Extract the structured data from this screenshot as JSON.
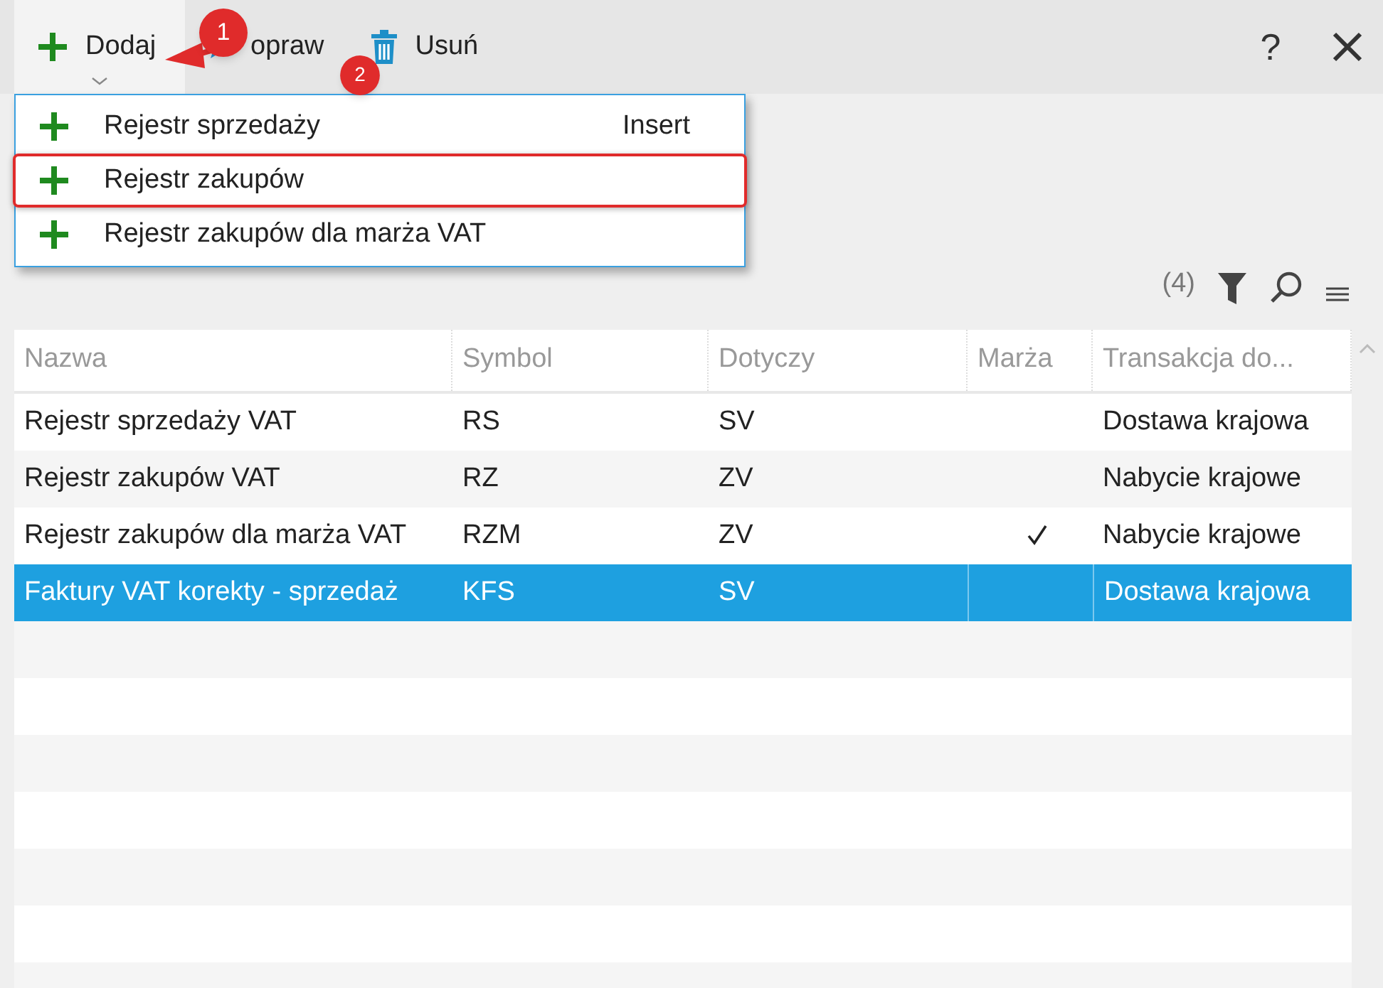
{
  "toolbar": {
    "buttons": [
      {
        "label": "Dodaj",
        "kind": "add",
        "open": true
      },
      {
        "label": "opraw",
        "kind": "edit",
        "open": false
      },
      {
        "label": "Usuń",
        "kind": "delete",
        "open": false
      }
    ],
    "help": "?"
  },
  "menu": {
    "items": [
      {
        "label": "Rejestr sprzedaży",
        "shortcut": "Insert",
        "highlighted": false
      },
      {
        "label": "Rejestr zakupów",
        "highlighted": true
      },
      {
        "label": "Rejestr zakupów dla marża VAT",
        "highlighted": false
      }
    ]
  },
  "badges": [
    "1",
    "2"
  ],
  "list_toolbar": {
    "count": "(4)"
  },
  "table": {
    "columns": [
      "Nazwa",
      "Symbol",
      "Dotyczy",
      "Marża",
      "Transakcja do..."
    ],
    "rows": [
      {
        "cells": [
          "Rejestr sprzedaży VAT",
          "RS",
          "SV",
          "Dostawa krajowa"
        ],
        "margin": false,
        "selected": false
      },
      {
        "cells": [
          "Rejestr zakupów VAT",
          "RZ",
          "ZV",
          "Nabycie krajowe"
        ],
        "margin": false,
        "selected": false
      },
      {
        "cells": [
          "Rejestr zakupów dla marża VAT",
          "RZM",
          "ZV",
          "Nabycie krajowe"
        ],
        "margin": true,
        "selected": false
      },
      {
        "cells": [
          "Faktury VAT korekty - sprzedaż",
          "KFS",
          "SV",
          "Dostawa krajowa"
        ],
        "margin": false,
        "selected": true
      }
    ]
  }
}
